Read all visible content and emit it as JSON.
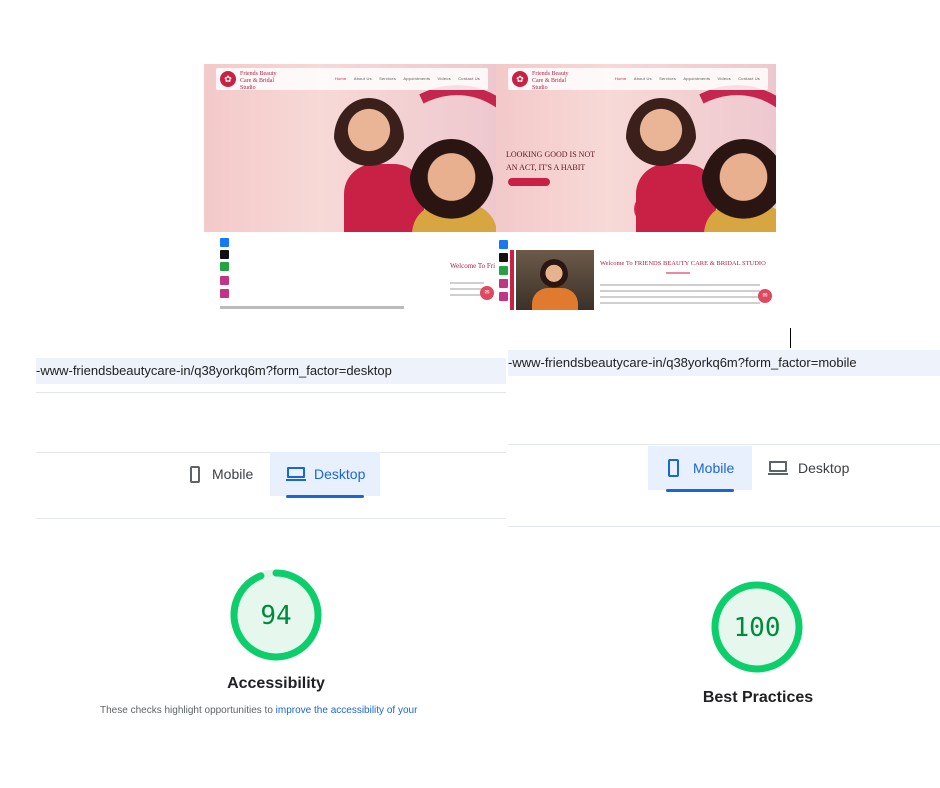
{
  "left_preview": {
    "logo_text": "Friends Beauty Care & Bridal Studio",
    "nav": [
      "Home",
      "About Us",
      "Services",
      "Appointments",
      "Videos",
      "Contact Us"
    ],
    "welcome_text": "Welcome To Fri"
  },
  "right_preview": {
    "logo_text": "Friends Beauty Care & Bridal Studio",
    "nav": [
      "Home",
      "About Us",
      "Services",
      "Appointments",
      "Videos",
      "Contact Us"
    ],
    "hero_line1": "LOOKING GOOD IS NOT",
    "hero_line2": "AN ACT, IT'S A HABIT",
    "welcome_text": "Welcome To FRIENDS BEAUTY CARE & BRIDAL STUDIO"
  },
  "left_panel": {
    "url": "-www-friendsbeautycare-in/q38yorkq6m?form_factor=desktop",
    "tabs": [
      {
        "label": "Mobile",
        "icon": "phone-icon",
        "active": false
      },
      {
        "label": "Desktop",
        "icon": "laptop-icon",
        "active": true
      }
    ],
    "score": {
      "value": "94",
      "fraction": 0.94,
      "category": "Accessibility",
      "color": "#0cce6b"
    },
    "description_prefix": "These checks highlight opportunities to ",
    "description_link": "improve the accessibility of your"
  },
  "right_panel": {
    "url": "-www-friendsbeautycare-in/q38yorkq6m?form_factor=mobile",
    "tabs": [
      {
        "label": "Mobile",
        "icon": "phone-icon",
        "active": true
      },
      {
        "label": "Desktop",
        "icon": "laptop-icon",
        "active": false
      }
    ],
    "score": {
      "value": "100",
      "fraction": 1.0,
      "category": "Best Practices",
      "color": "#0cce6b"
    }
  }
}
